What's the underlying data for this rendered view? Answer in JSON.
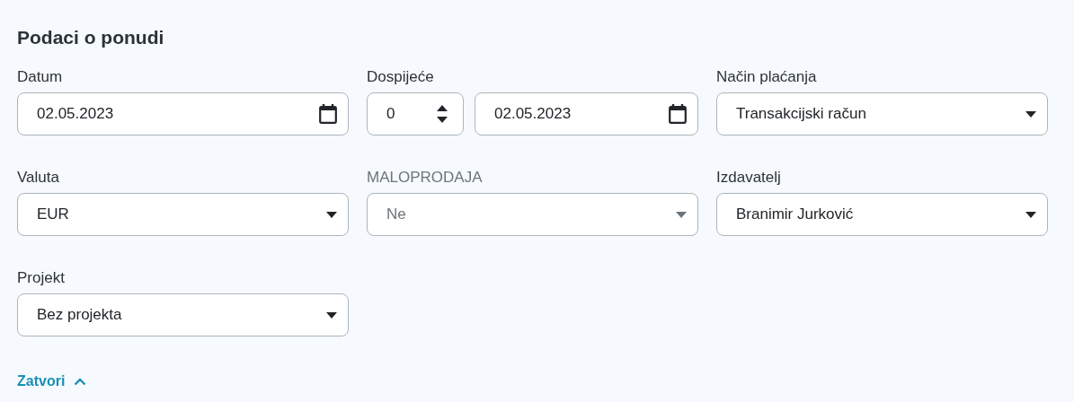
{
  "title": "Podaci o ponudi",
  "fields": [
    {
      "kind": "date",
      "label": "Datum",
      "value": "02.05.2023",
      "disabled": false
    },
    {
      "kind": "due",
      "label": "Dospijeće",
      "days": "0",
      "value": "02.05.2023",
      "disabled": false
    },
    {
      "kind": "select",
      "label": "Način plaćanja",
      "value": "Transakcijski račun",
      "disabled": false
    },
    {
      "kind": "select",
      "label": "Valuta",
      "value": "EUR",
      "disabled": false
    },
    {
      "kind": "select",
      "label": "MALOPRODAJA",
      "value": "Ne",
      "disabled": true
    },
    {
      "kind": "select",
      "label": "Izdavatelj",
      "value": "Branimir Jurković",
      "disabled": false
    },
    {
      "kind": "select",
      "label": "Projekt",
      "value": "Bez projekta",
      "disabled": false
    }
  ],
  "toggle": {
    "label": "Zatvori",
    "expanded": true
  }
}
